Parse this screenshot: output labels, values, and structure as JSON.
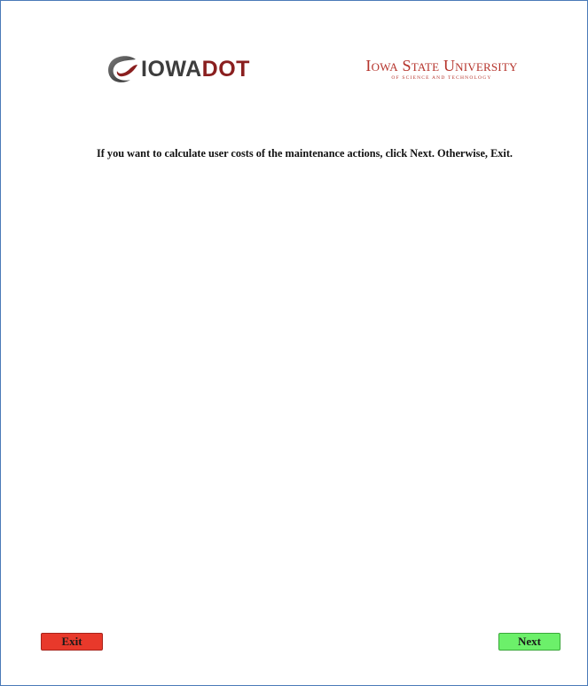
{
  "logos": {
    "iowa_dot": {
      "part1": "IOWA",
      "part2": "DOT",
      "icon": "iowa-dot-swirl-icon",
      "colors": {
        "iowa": "#3d3d3d",
        "dot": "#8a1f1f"
      }
    },
    "isu": {
      "name": "Iowa State University",
      "subtitle": "OF SCIENCE AND TECHNOLOGY",
      "color": "#b5332b"
    }
  },
  "prompt": "If you want to calculate user costs of the maintenance actions, click Next. Otherwise, Exit.",
  "buttons": {
    "exit": {
      "label": "Exit",
      "color": "#e8392b"
    },
    "next": {
      "label": "Next",
      "color": "#6cf06a"
    }
  },
  "colors": {
    "frame_border": "#4a7ab8"
  }
}
